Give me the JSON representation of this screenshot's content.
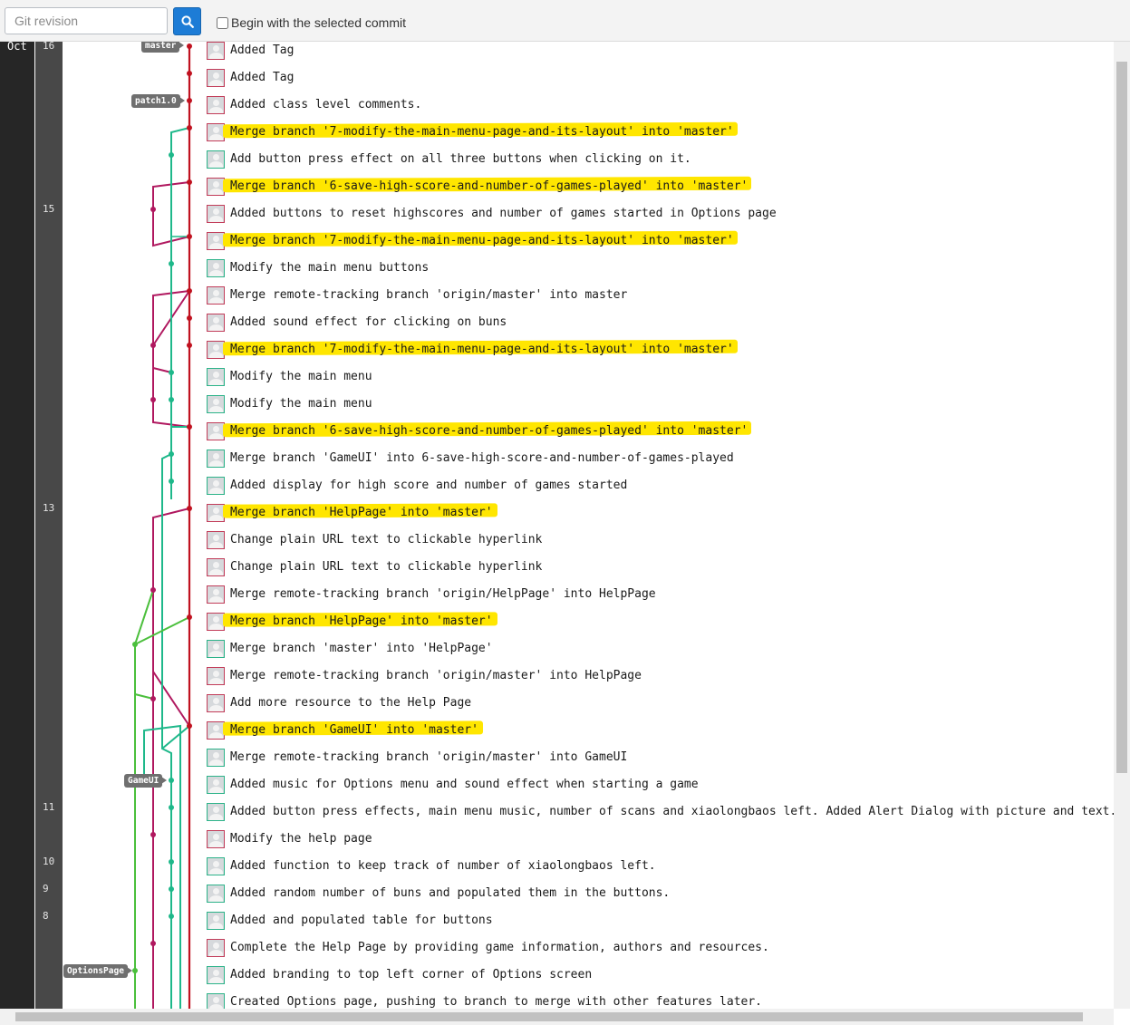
{
  "toolbar": {
    "revision_placeholder": "Git revision",
    "search_icon": "search-icon",
    "begin_checkbox_label": "Begin with the selected commit",
    "begin_checkbox_checked": false
  },
  "dates": {
    "month": "Oct",
    "days": [
      "16",
      "15",
      "13",
      "11",
      "10",
      "9",
      "8"
    ]
  },
  "refs": [
    "master",
    "patch1.0",
    "GameUI",
    "OptionsPage"
  ],
  "colors": {
    "master_lane": "#c0111f",
    "red_lane": "#b0185f",
    "teal_lane": "#1eb88a",
    "green_lane": "#4bbf3c",
    "highlight": "#ffe600"
  },
  "commits": [
    {
      "message": "Added Tag",
      "highlighted": false
    },
    {
      "message": "Added Tag",
      "highlighted": false
    },
    {
      "message": "Added class level comments.",
      "highlighted": false
    },
    {
      "message": "Merge branch '7-modify-the-main-menu-page-and-its-layout' into 'master'",
      "highlighted": true
    },
    {
      "message": "Add button press effect on all three buttons when clicking on it.",
      "highlighted": false
    },
    {
      "message": "Merge branch '6-save-high-score-and-number-of-games-played' into 'master'",
      "highlighted": true
    },
    {
      "message": "Added buttons to reset highscores and number of games started in Options page",
      "highlighted": false
    },
    {
      "message": "Merge branch '7-modify-the-main-menu-page-and-its-layout' into 'master'",
      "highlighted": true
    },
    {
      "message": "Modify the main menu buttons",
      "highlighted": false
    },
    {
      "message": "Merge remote-tracking branch 'origin/master' into master",
      "highlighted": false
    },
    {
      "message": "Added sound effect for clicking on buns",
      "highlighted": false
    },
    {
      "message": "Merge branch '7-modify-the-main-menu-page-and-its-layout' into 'master'",
      "highlighted": true
    },
    {
      "message": "Modify the main menu",
      "highlighted": false
    },
    {
      "message": "Modify the main menu",
      "highlighted": false
    },
    {
      "message": "Merge branch '6-save-high-score-and-number-of-games-played' into 'master'",
      "highlighted": true
    },
    {
      "message": "Merge branch 'GameUI' into 6-save-high-score-and-number-of-games-played",
      "highlighted": false
    },
    {
      "message": "Added display for high score and number of games started",
      "highlighted": false
    },
    {
      "message": "Merge branch 'HelpPage' into 'master'",
      "highlighted": true
    },
    {
      "message": "Change plain URL text to clickable hyperlink",
      "highlighted": false
    },
    {
      "message": "Change plain URL text to clickable hyperlink",
      "highlighted": false
    },
    {
      "message": "Merge remote-tracking branch 'origin/HelpPage' into HelpPage",
      "highlighted": false
    },
    {
      "message": "Merge branch 'HelpPage' into 'master'",
      "highlighted": true
    },
    {
      "message": "Merge branch 'master' into 'HelpPage'",
      "highlighted": false
    },
    {
      "message": "Merge remote-tracking branch 'origin/master' into HelpPage",
      "highlighted": false
    },
    {
      "message": "Add more resource to the Help Page",
      "highlighted": false
    },
    {
      "message": "Merge branch 'GameUI' into 'master'",
      "highlighted": true
    },
    {
      "message": "Merge remote-tracking branch 'origin/master' into GameUI",
      "highlighted": false
    },
    {
      "message": "Added music for Options menu and sound effect when starting a game",
      "highlighted": false
    },
    {
      "message": "Added button press effects, main menu music, number of scans and xiaolongbaos left. Added Alert Dialog with picture and text.",
      "highlighted": false
    },
    {
      "message": "Modify the help page",
      "highlighted": false
    },
    {
      "message": "Added function to keep track of number of xiaolongbaos left.",
      "highlighted": false
    },
    {
      "message": "Added random number of buns and populated them in the buttons.",
      "highlighted": false
    },
    {
      "message": "Added and populated table for buttons",
      "highlighted": false
    },
    {
      "message": "Complete the Help Page by providing game information, authors and resources.",
      "highlighted": false
    },
    {
      "message": "Added branding to top left corner of Options screen",
      "highlighted": false
    },
    {
      "message": "Created Options page, pushing to branch to merge with other features later.",
      "highlighted": false
    }
  ]
}
